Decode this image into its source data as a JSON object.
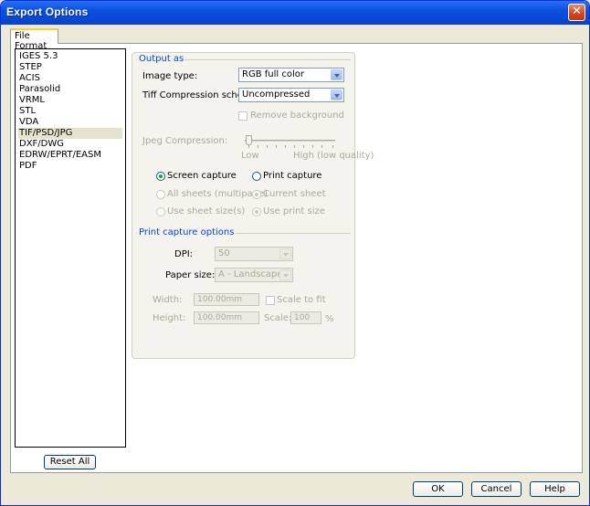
{
  "window": {
    "title": "Export Options",
    "close_glyph": "✕"
  },
  "tab": {
    "label": "File Format"
  },
  "formats": [
    "IGES 5.3",
    "STEP",
    "ACIS",
    "Parasolid",
    "VRML",
    "STL",
    "VDA",
    "TIF/PSD/JPG",
    "DXF/DWG",
    "EDRW/EPRT/EASM",
    "PDF"
  ],
  "selected_format_index": 7,
  "reset_label": "Reset All",
  "output": {
    "group_title": "Output as",
    "image_type_label": "Image type:",
    "image_type_value": "RGB full color",
    "tiff_label": "Tiff Compression scheme:",
    "tiff_value": "Uncompressed",
    "remove_bg_label": "Remove background",
    "jpeg_label": "Jpeg Compression:",
    "jpeg_low": "Low",
    "jpeg_high": "High (low quality)",
    "screen_capture": "Screen capture",
    "print_capture": "Print capture",
    "all_sheets": "All sheets (multipage)",
    "current_sheet": "Current sheet",
    "use_sheet_size": "Use sheet size(s)",
    "use_print_size": "Use print size"
  },
  "print_opts": {
    "group_title": "Print capture options",
    "dpi_label": "DPI:",
    "dpi_value": "50",
    "paper_label": "Paper size:",
    "paper_value": "A - Landscape",
    "width_label": "Width:",
    "width_value": "100.00mm",
    "height_label": "Height:",
    "height_value": "100.00mm",
    "scale_to_fit": "Scale to fit",
    "scale_label": "Scale:",
    "scale_value": "100",
    "percent": "%"
  },
  "buttons": {
    "ok": "OK",
    "cancel": "Cancel",
    "help": "Help"
  }
}
